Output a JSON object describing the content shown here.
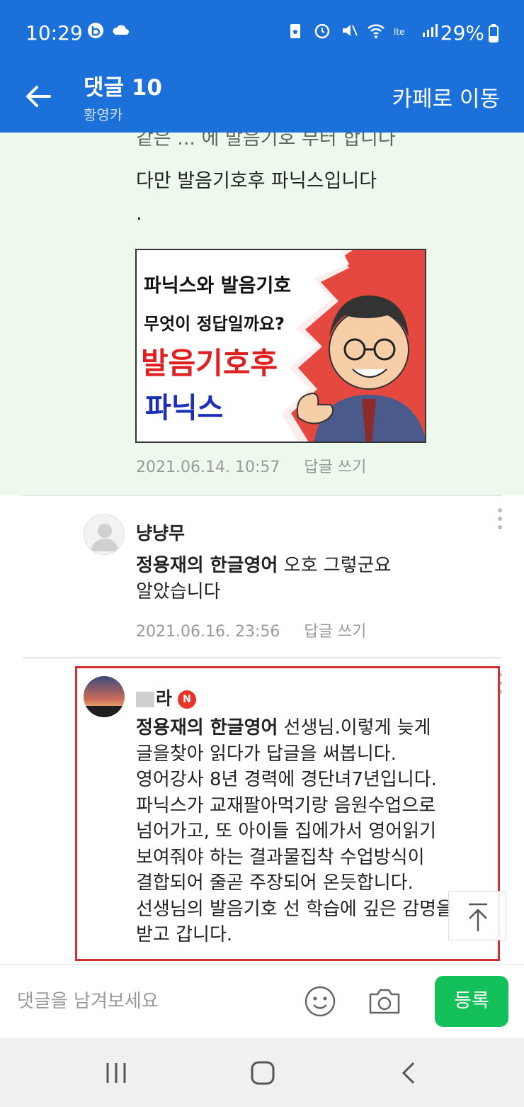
{
  "status_bar": {
    "time": "10:29",
    "battery": "29%"
  },
  "header": {
    "title": "댓글 10",
    "subtitle": "황영카",
    "goto_cafe": "카페로 이동"
  },
  "comments": [
    {
      "cut_text": "같은 ... 에 발음기호 부터 합니다",
      "text": "다만 발음기호후 파닉스입니다\n.",
      "image_text": {
        "line1": "파닉스와  발음기호",
        "line2": "무엇이 정답일까요?",
        "line3": "발음기호후",
        "line4": "파닉스"
      },
      "date": "2021.06.14. 10:57",
      "reply": "답글 쓰기"
    },
    {
      "nickname": "냥냥무",
      "mention": "정용재의 한글영어",
      "text": " 오호 그렇군요\n알았습니다",
      "date": "2021.06.16. 23:56",
      "reply": "답글 쓰기"
    },
    {
      "nickname": "라",
      "badge": "N",
      "mention": "정용재의 한글영어",
      "text": " 선생님.이렇게 늦게\n글을찾아 읽다가 답글을 써봅니다.\n영어강사 8년 경력에 경단녀7년입니다.\n파닉스가 교재팔아먹기랑 음원수업으로\n넘어가고, 또 아이들 집에가서 영어읽기\n보여줘야 하는 결과물집착 수업방식이\n결합되어 줄곧 주장되어 온듯합니다.\n선생님의 발음기호 선 학습에 깊은 감명을\n받고 갑니다."
    }
  ],
  "input": {
    "placeholder": "댓글을 남겨보세요",
    "submit": "등록"
  },
  "colors": {
    "header_bg": "#1c70d9",
    "highlight_bg": "#eef9ee",
    "submit_bg": "#14c05a",
    "annotation_box": "#d32f2f"
  }
}
